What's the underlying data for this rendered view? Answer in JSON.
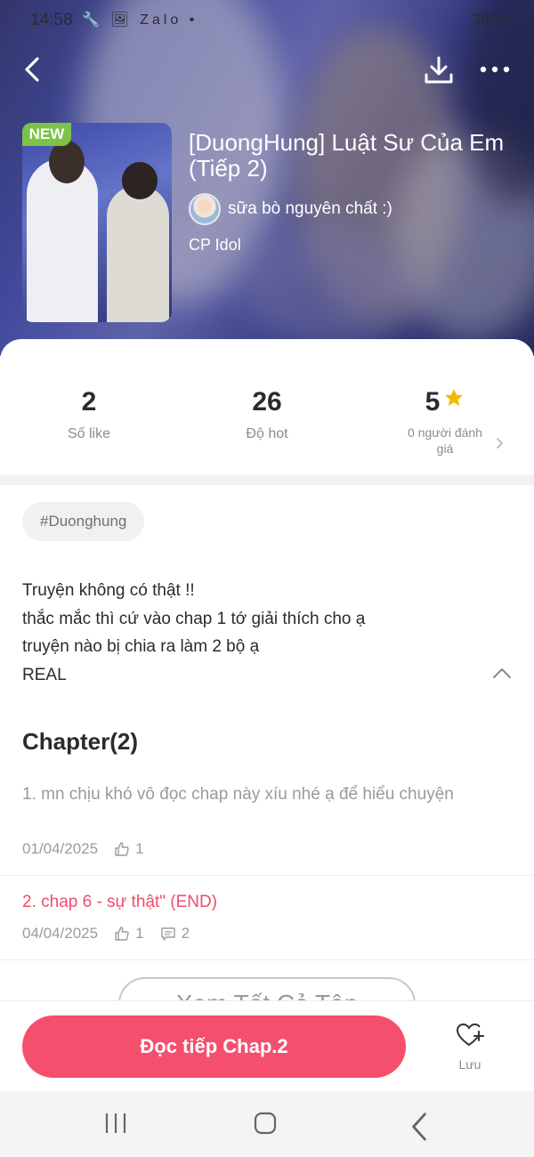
{
  "status_bar": {
    "time": "14:58",
    "icons": "🔧 🖼 Zalo •",
    "right": "38%"
  },
  "header": {
    "badge": "NEW",
    "title": "[DuongHung] Luật Sư Của Em (Tiếp 2)",
    "author": "sữa bò nguyên chất :)",
    "category": "CP Idol",
    "icons": [
      "back-arrow-icon",
      "download-icon",
      "more-icon"
    ]
  },
  "stats": {
    "likes": {
      "value": "2",
      "label": "Số like"
    },
    "hot": {
      "value": "26",
      "label": "Độ hot"
    },
    "rating": {
      "value": "5",
      "label": "0 người đánh giá"
    }
  },
  "tag": "#Duonghung",
  "description": [
    "Truyện không có thật !!",
    "thắc mắc thì cứ vào chap 1 tớ giải thích cho ạ",
    "truyện nào bị chia ra làm 2 bộ ạ",
    "REAL"
  ],
  "chapters": {
    "heading": "Chapter(2)",
    "items": [
      {
        "name": "1. mn chịu khó vô đọc chap này xíu nhé ạ để hiểu chuyện",
        "date": "01/04/2025",
        "likes": "1",
        "comments": ""
      },
      {
        "name": "2. chap 6 - sự thật\" (END)",
        "date": "04/04/2025",
        "likes": "1",
        "comments": "2"
      }
    ],
    "see_all": "Xem Tất Cả Tập"
  },
  "bottom": {
    "read_button": "Đọc tiếp Chap.2",
    "save_label": "Lưu"
  },
  "colors": {
    "accent": "#f4506e",
    "badge": "#7cc348",
    "star": "#f5b800"
  }
}
